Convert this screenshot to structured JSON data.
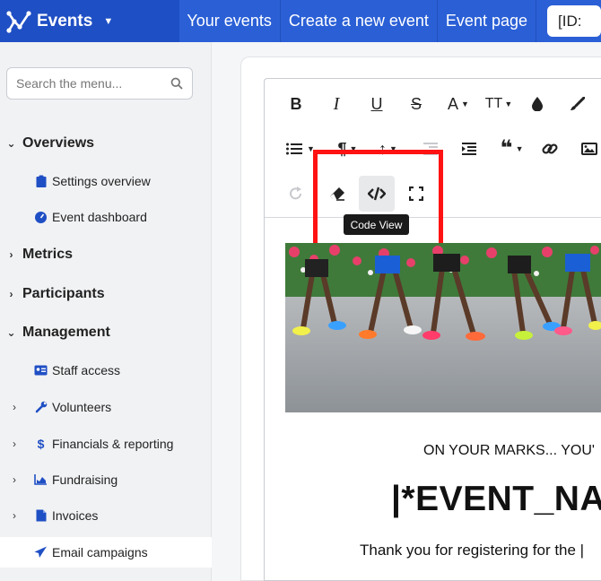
{
  "topbar": {
    "brand": "Events",
    "nav": [
      "Your events",
      "Create a new event",
      "Event page"
    ],
    "id_box": "[ID:"
  },
  "sidebar": {
    "search_placeholder": "Search the menu...",
    "sections": {
      "overviews": "Overviews",
      "metrics": "Metrics",
      "participants": "Participants",
      "management": "Management"
    },
    "items": {
      "settings_overview": "Settings overview",
      "event_dashboard": "Event dashboard",
      "staff_access": "Staff access",
      "volunteers": "Volunteers",
      "financials": "Financials & reporting",
      "fundraising": "Fundraising",
      "invoices": "Invoices",
      "email_campaigns": "Email campaigns"
    }
  },
  "toolbar": {
    "tooltip": "Code View",
    "font_glyph": "A",
    "size_glyph": "TT"
  },
  "content": {
    "line1": "ON YOUR MARKS... YOU'",
    "line2": "|*EVENT_NA",
    "line3": "Thank you for registering for the |"
  },
  "colors": {
    "topbar": "#1f4fc4",
    "nav": "#2a5fd6",
    "accent_icon": "#1f4fc4",
    "highlight": "#ff1212"
  }
}
